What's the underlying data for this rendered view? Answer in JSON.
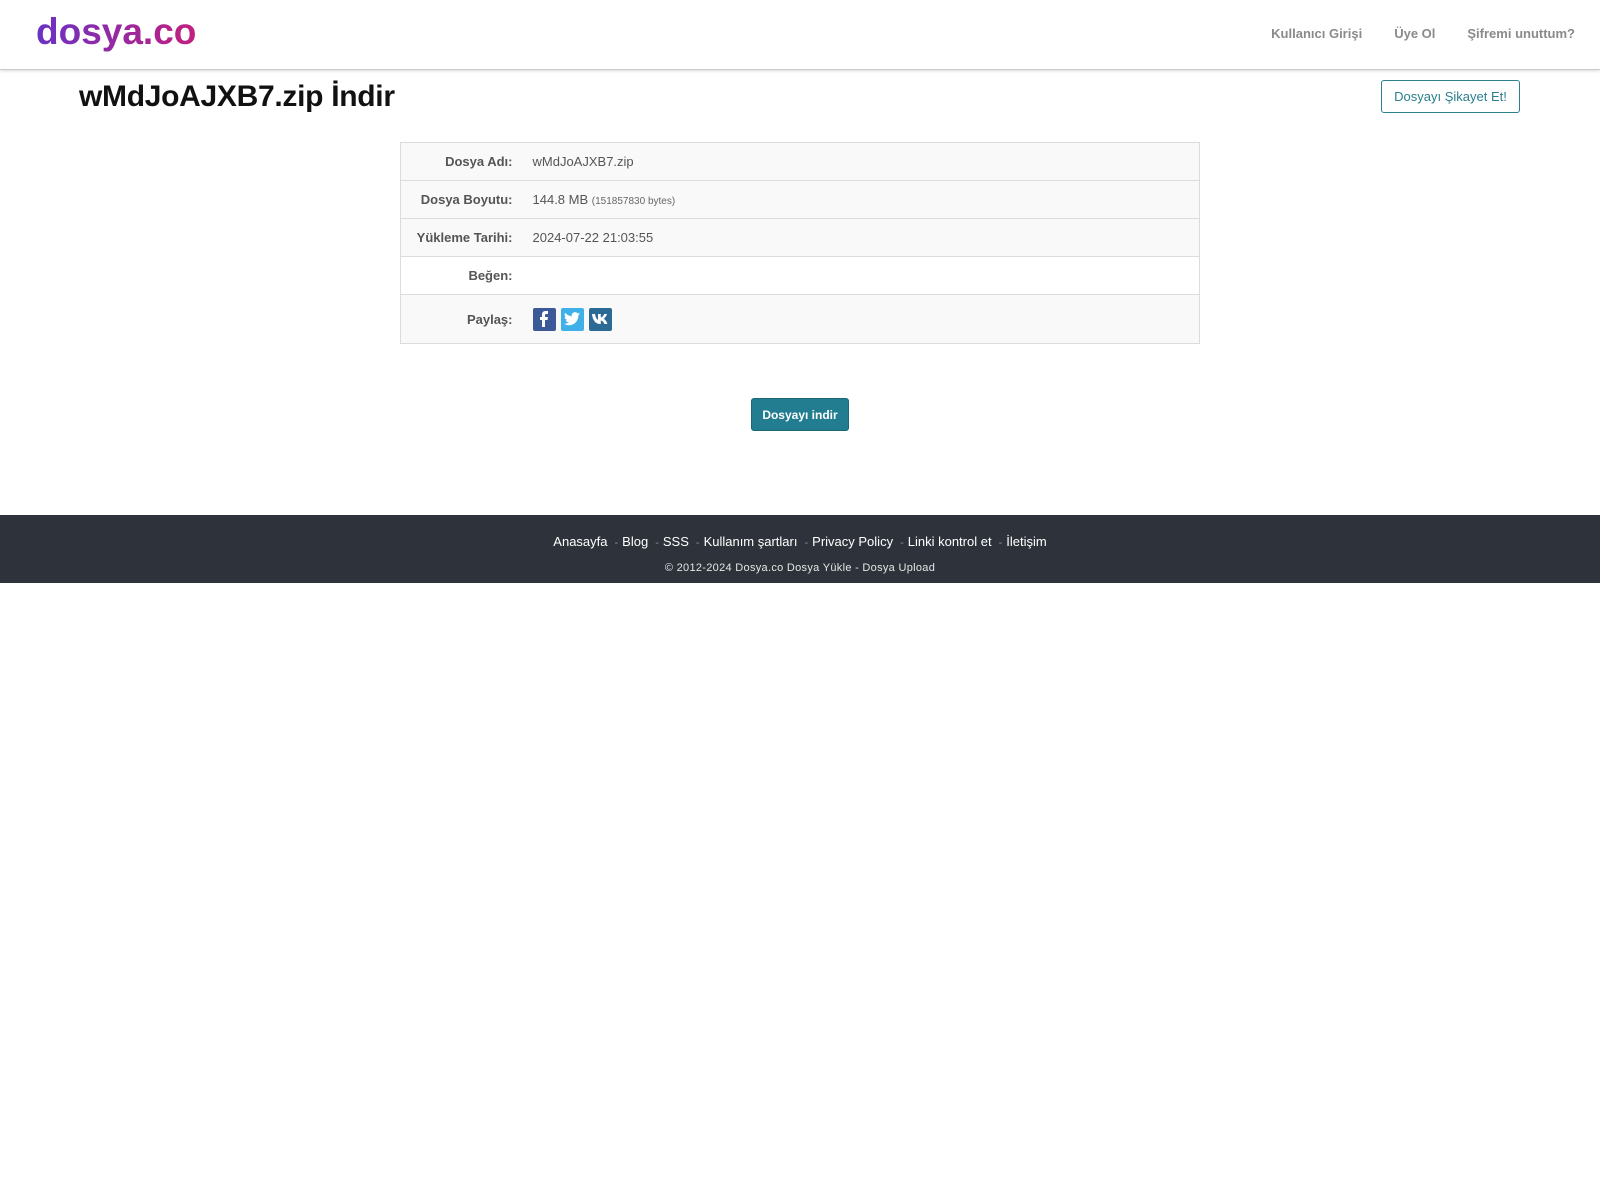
{
  "header": {
    "logo_text": "dosya.co",
    "nav": [
      {
        "label": "Kullanıcı Girişi"
      },
      {
        "label": "Üye Ol"
      },
      {
        "label": "Şifremi unuttum?"
      }
    ]
  },
  "page": {
    "title": "wMdJoAJXB7.zip İndir",
    "report_label": "Dosyayı Şikayet Et!"
  },
  "file_info": {
    "name_label": "Dosya Adı:",
    "name_value": "wMdJoAJXB7.zip",
    "size_label": "Dosya Boyutu:",
    "size_value": "144.8 MB",
    "size_bytes": "(151857830 bytes)",
    "date_label": "Yükleme Tarihi:",
    "date_value": "2024-07-22 21:03:55",
    "like_label": "Beğen:",
    "share_label": "Paylaş:",
    "share_icons": [
      "facebook-icon",
      "twitter-icon",
      "vk-icon"
    ]
  },
  "download_label": "Dosyayı indir",
  "footer": {
    "links": [
      "Anasayfa",
      "Blog",
      "SSS",
      "Kullanım şartları",
      "Privacy Policy",
      "Linki kontrol et",
      "İletişim"
    ],
    "copyright": "© 2012-2024 Dosya.co Dosya Yükle - Dosya Upload"
  },
  "colors": {
    "accent": "#217d8f",
    "footer_bg": "#2e333b",
    "logo_purple": "#7b2fbf",
    "logo_magenta": "#c0208f"
  }
}
